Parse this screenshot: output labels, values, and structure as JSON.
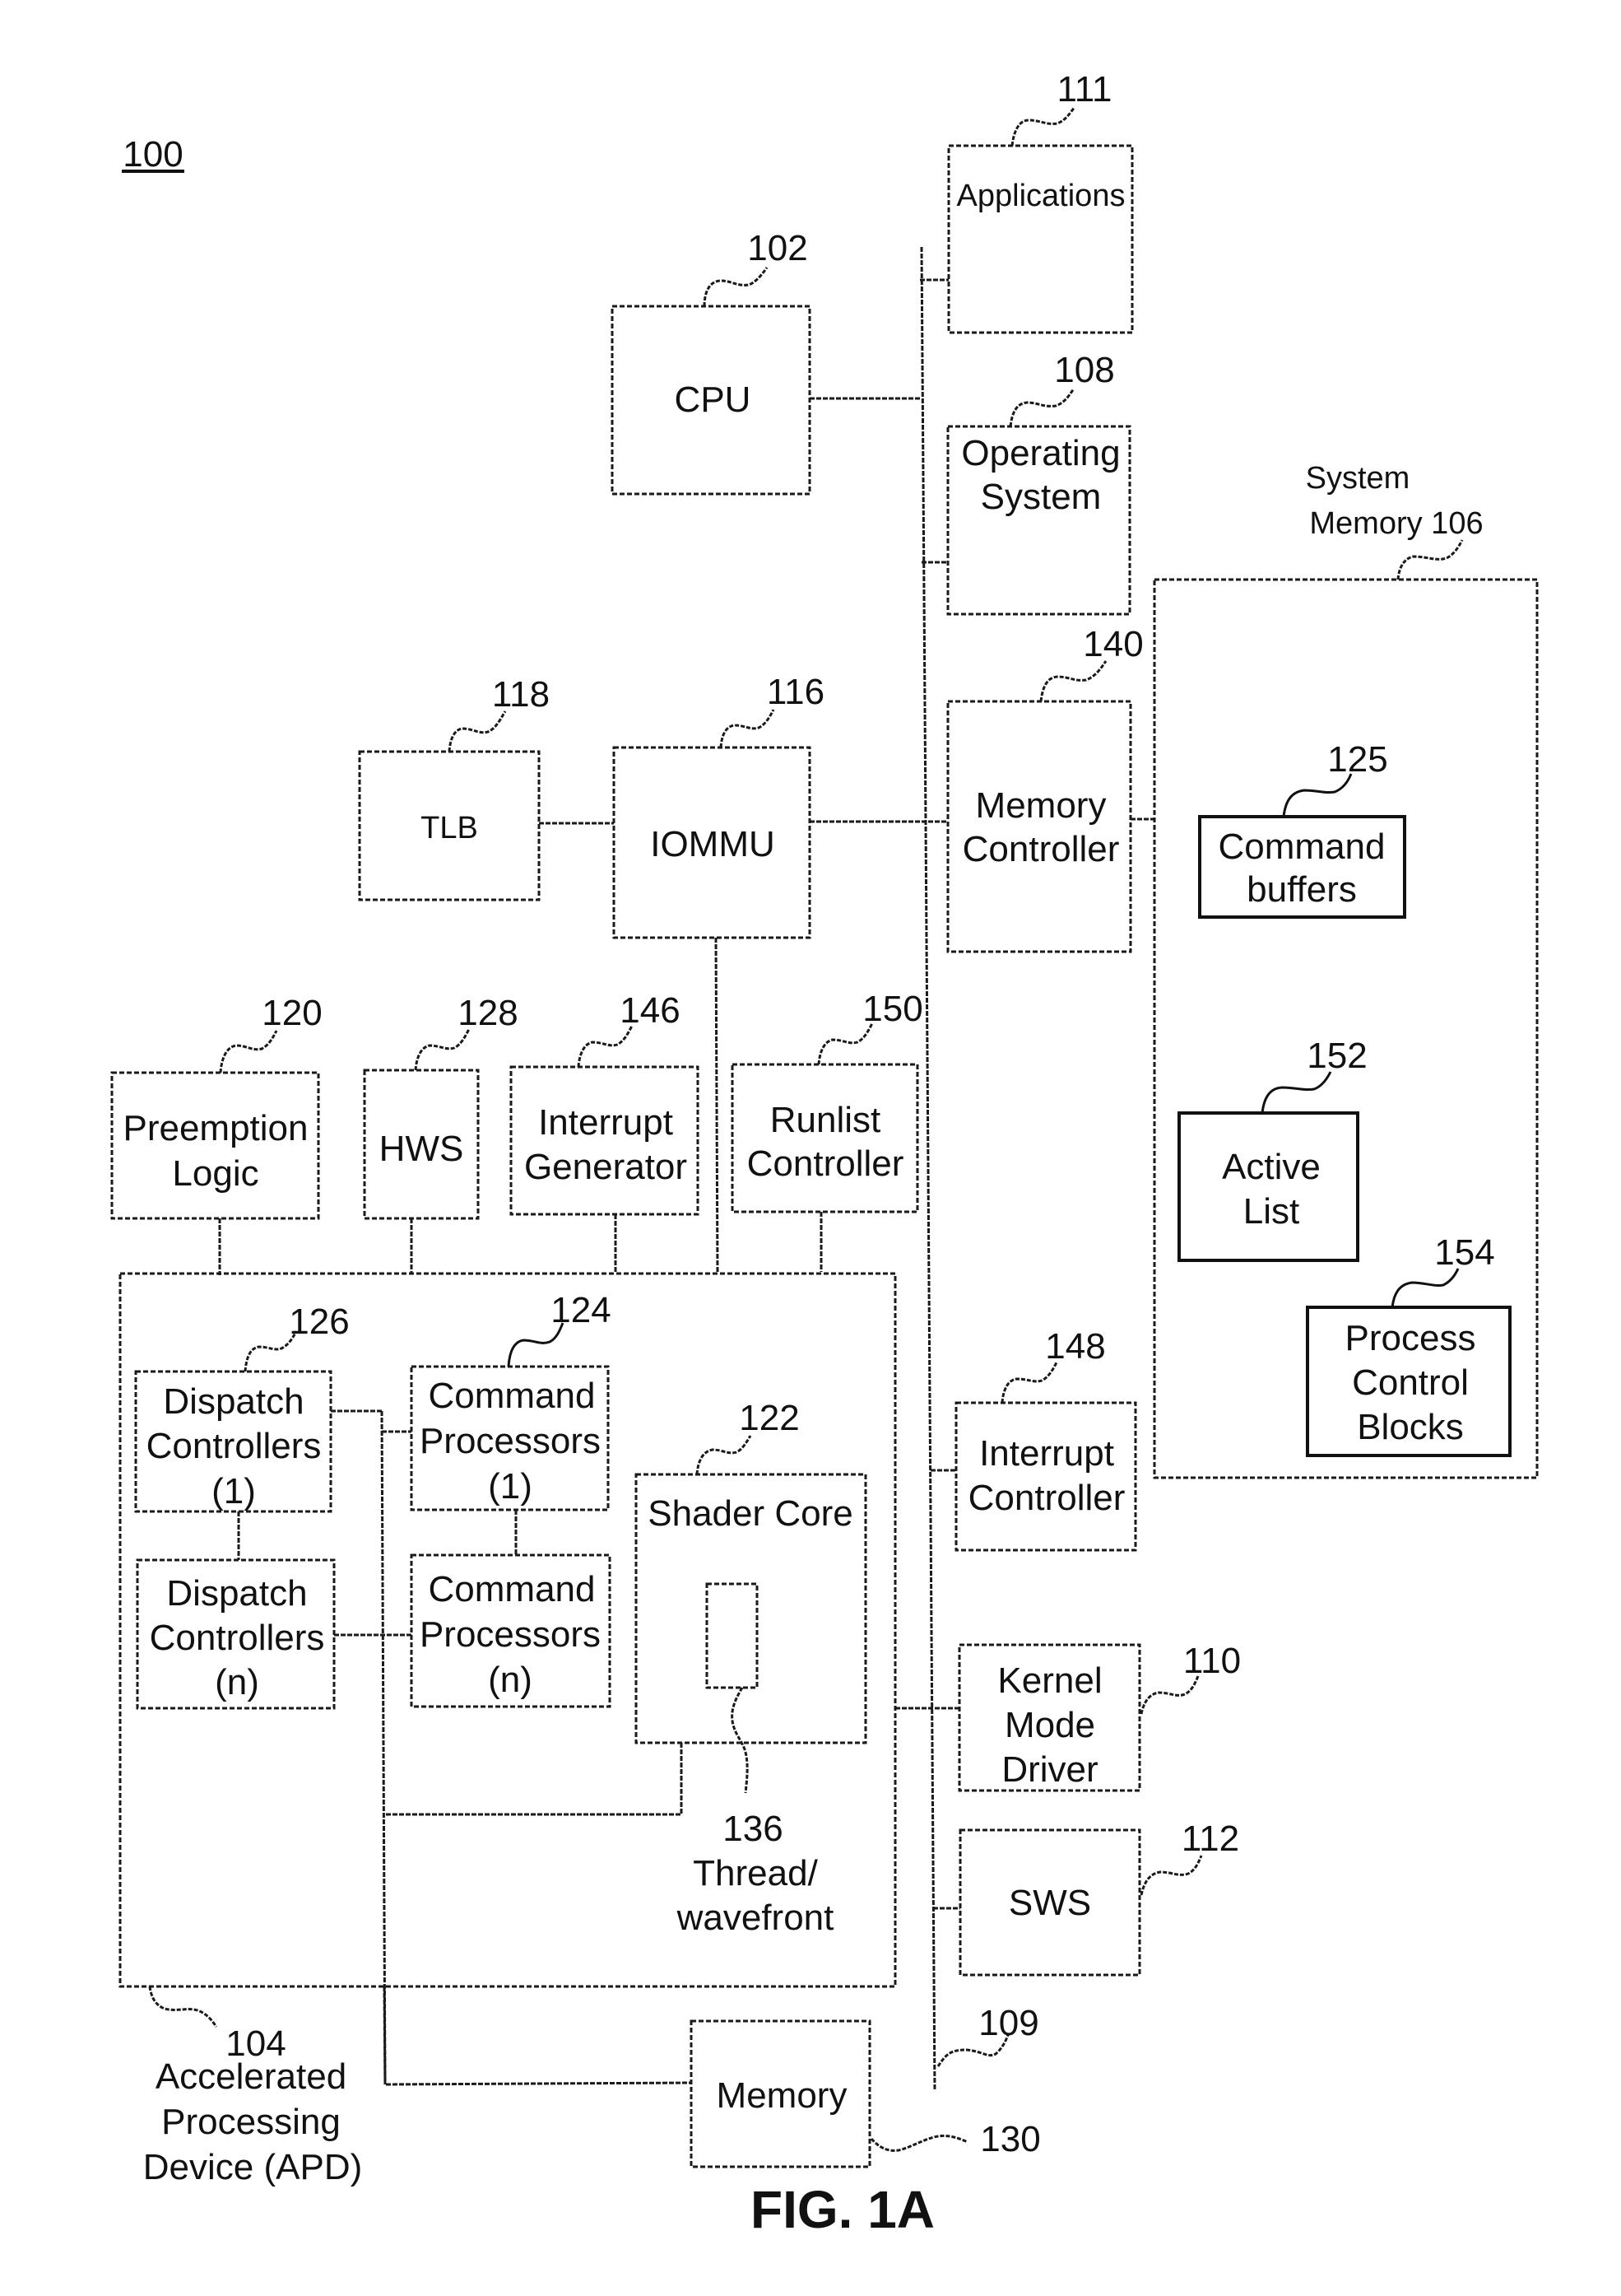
{
  "figure": {
    "number_label": "100",
    "caption": "FIG. 1A"
  },
  "blocks": {
    "applications": {
      "ref": "111",
      "lines": [
        "Applications"
      ]
    },
    "cpu": {
      "ref": "102",
      "lines": [
        "CPU"
      ]
    },
    "operating_system": {
      "ref": "108",
      "lines": [
        "Operating",
        "System"
      ]
    },
    "memory_controller": {
      "ref": "140",
      "lines": [
        "Memory",
        "Controller"
      ]
    },
    "system_memory": {
      "ref_lines": [
        "System",
        "Memory 106"
      ]
    },
    "command_buffers": {
      "ref": "125",
      "lines": [
        "Command",
        "buffers"
      ]
    },
    "active_list": {
      "ref": "152",
      "lines": [
        "Active",
        "List"
      ]
    },
    "process_control_blocks": {
      "ref": "154",
      "lines": [
        "Process",
        "Control",
        "Blocks"
      ]
    },
    "tlb": {
      "ref": "118",
      "lines": [
        "TLB"
      ]
    },
    "iommu": {
      "ref": "116",
      "lines": [
        "IOMMU"
      ]
    },
    "preemption_logic": {
      "ref": "120",
      "lines": [
        "Preemption",
        "Logic"
      ]
    },
    "hws": {
      "ref": "128",
      "lines": [
        "HWS"
      ]
    },
    "interrupt_generator": {
      "ref": "146",
      "lines": [
        "Interrupt",
        "Generator"
      ]
    },
    "runlist_controller": {
      "ref": "150",
      "lines": [
        "Runlist",
        "Controller"
      ]
    },
    "dispatch_controllers_1": {
      "ref": "126",
      "lines": [
        "Dispatch",
        "Controllers",
        "(1)"
      ]
    },
    "dispatch_controllers_n": {
      "lines": [
        "Dispatch",
        "Controllers",
        "(n)"
      ]
    },
    "command_processors_1": {
      "ref": "124",
      "lines": [
        "Command",
        "Processors",
        "(1)"
      ]
    },
    "command_processors_n": {
      "lines": [
        "Command",
        "Processors",
        "(n)"
      ]
    },
    "shader_core": {
      "ref": "122",
      "lines": [
        "Shader Core"
      ]
    },
    "thread_wavefront": {
      "ref": "136",
      "lines": [
        "Thread/",
        "wavefront"
      ]
    },
    "apd": {
      "ref": "104",
      "lines": [
        "Accelerated",
        "Processing",
        "Device (APD)"
      ]
    },
    "interrupt_controller": {
      "ref": "148",
      "lines": [
        "Interrupt",
        "Controller"
      ]
    },
    "kernel_mode_driver": {
      "ref": "110",
      "lines": [
        "Kernel",
        "Mode",
        "Driver"
      ]
    },
    "sws": {
      "ref": "112",
      "lines": [
        "SWS"
      ]
    },
    "memory": {
      "ref": "130",
      "lines": [
        "Memory"
      ]
    },
    "bus": {
      "ref": "109"
    }
  }
}
